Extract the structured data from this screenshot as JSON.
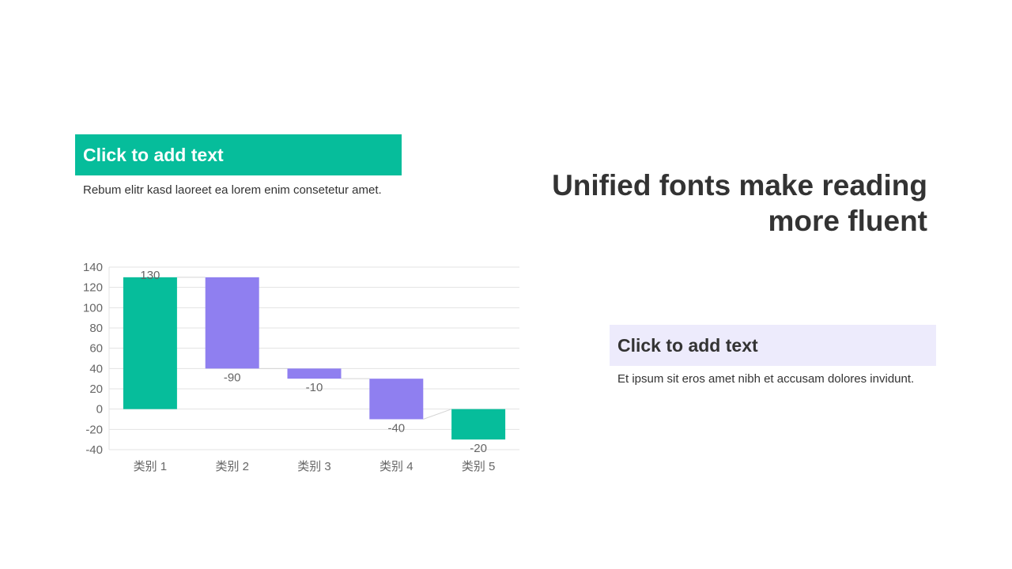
{
  "left_box": {
    "title": "Click to add text",
    "body": "Rebum elitr kasd laoreet ea lorem enim consetetur amet."
  },
  "headline": {
    "line1": "Unified fonts make reading",
    "line2": "more fluent"
  },
  "right_box": {
    "title": "Click to add text",
    "body": "Et ipsum sit eros amet nibh et accusam dolores invidunt."
  },
  "colors": {
    "accent_green": "#06bd9b",
    "accent_purple": "#8f7ff0",
    "light_purple": "#edebfc",
    "text_dark": "#333333",
    "axis_text": "#666666"
  },
  "chart_data": {
    "type": "bar",
    "subtype": "waterfall",
    "categories": [
      "类别 1",
      "类别 2",
      "类别 3",
      "类别 4",
      "类别 5"
    ],
    "values": [
      130,
      -90,
      -10,
      -40,
      -20
    ],
    "data_labels": [
      "130",
      "-90",
      "-10",
      "-40",
      "-20"
    ],
    "bar_types": [
      "total",
      "decrease",
      "decrease",
      "decrease",
      "total"
    ],
    "ylim": [
      -40,
      140
    ],
    "yticks": [
      140,
      120,
      100,
      80,
      60,
      40,
      20,
      0,
      -20,
      -40
    ],
    "title": "",
    "xlabel": "",
    "ylabel": "",
    "grid": true,
    "legend": "none"
  }
}
